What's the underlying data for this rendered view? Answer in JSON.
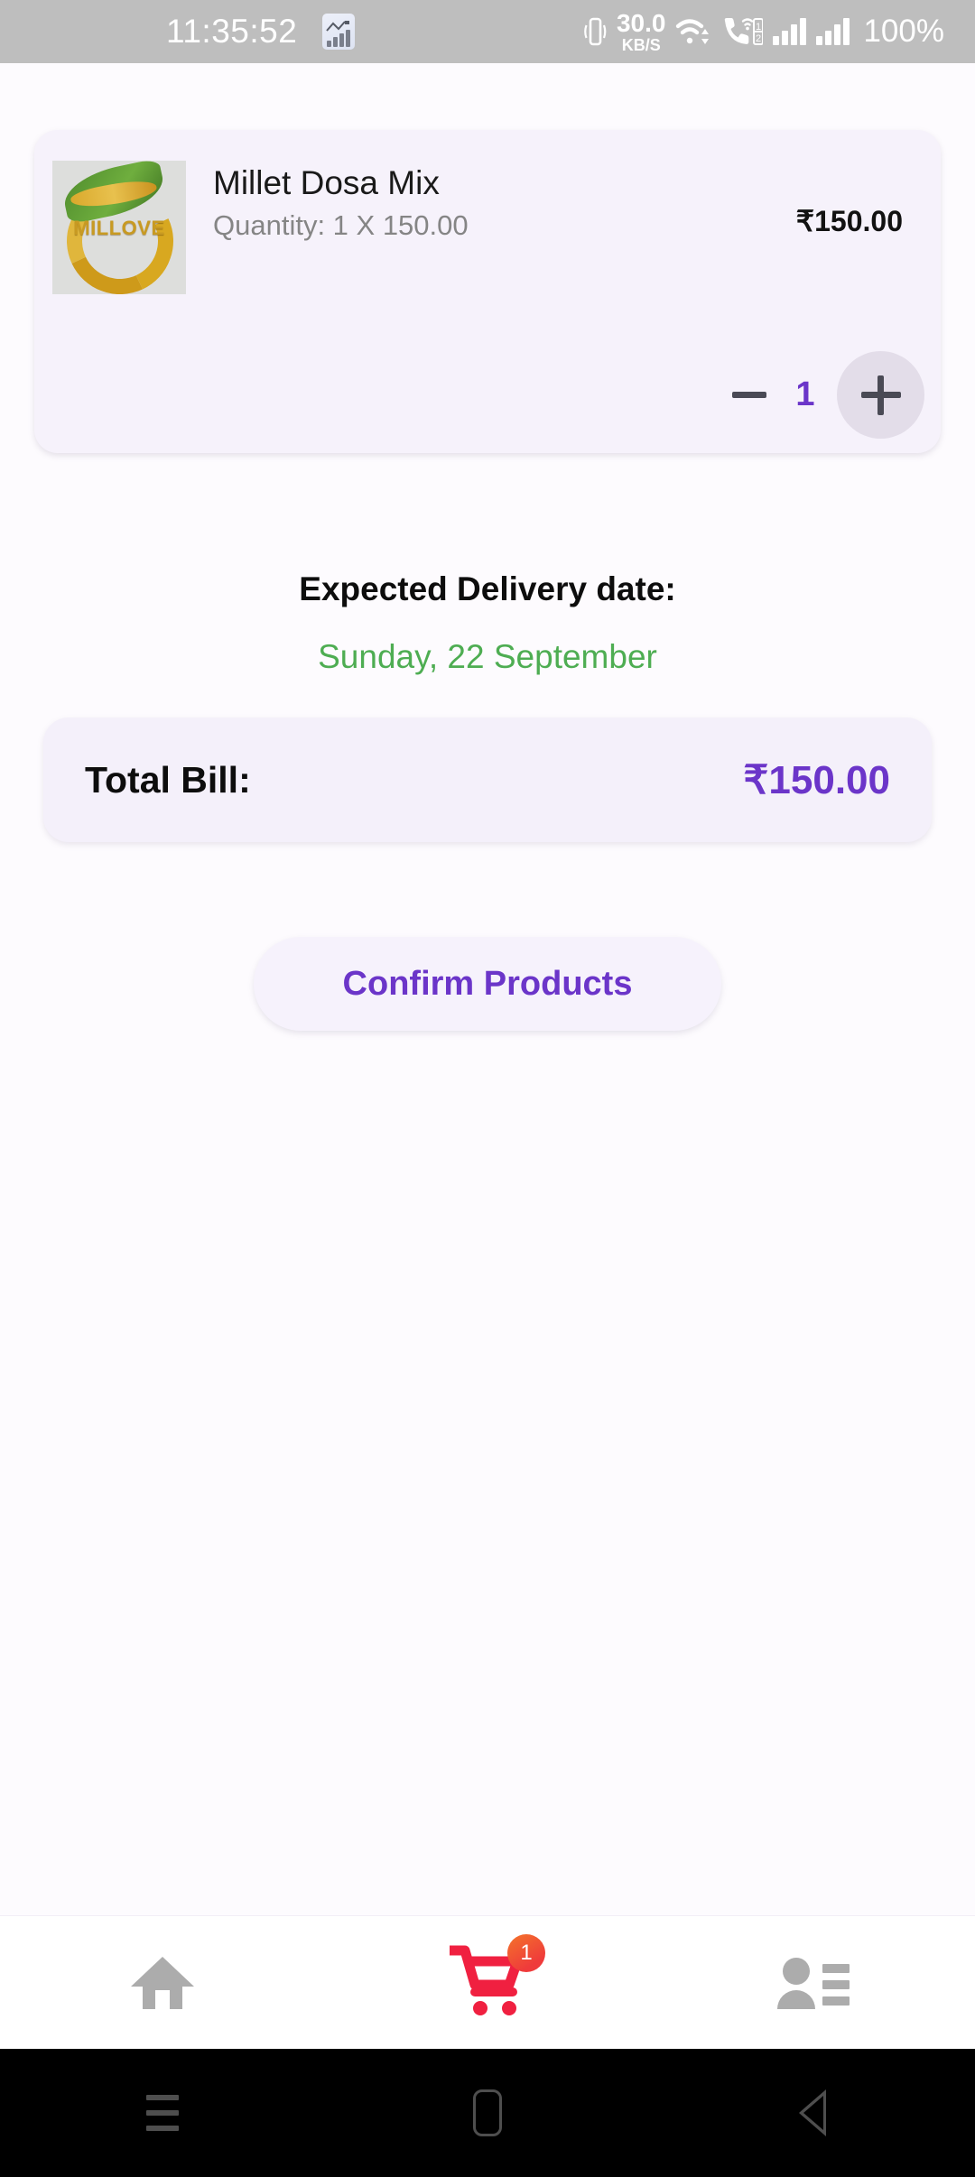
{
  "status_bar": {
    "clock": "11:35:52",
    "notification_icon": "stock-chart-icon",
    "vibrate_icon": "vibrate-icon",
    "network_speed_value": "30.0",
    "network_speed_unit": "KB/S",
    "wifi_icon": "wifi-icon",
    "call_wifi_icon": "vowifi-call-icon",
    "dual_sim_top": "1",
    "dual_sim_bottom": "2",
    "signal_icon_1": "signal-bars-icon",
    "signal_icon_2": "signal-bars-icon",
    "battery_percent": "100%",
    "background_color": "#BEBEBE",
    "text_color": "#FFFFFF"
  },
  "product": {
    "thumbnail_brand": "MILLOVE",
    "thumbnail_alt": "millet-product-image",
    "title": "Millet Dosa Mix",
    "quantity_line": "Quantity: 1 X 150.00",
    "price": "₹150.00",
    "stepper": {
      "decrease_label": "−",
      "value": "1",
      "increase_label": "+",
      "value_color": "#6B35C9",
      "plus_button_bg": "#E3DDE9"
    },
    "card_background": "#F6F2FB"
  },
  "delivery": {
    "label": "Expected Delivery date:",
    "date": "Sunday, 22 September",
    "date_color": "#4EAD52"
  },
  "total": {
    "label": "Total Bill:",
    "amount": "₹150.00",
    "amount_color": "#6B35C9",
    "card_background": "#F4F0FA"
  },
  "actions": {
    "confirm_label": "Confirm Products",
    "confirm_text_color": "#6B35C9",
    "confirm_background": "#F6F2FC"
  },
  "bottom_nav": {
    "items": [
      {
        "name": "home",
        "icon": "home-icon",
        "color": "#ACACAC",
        "badge": ""
      },
      {
        "name": "cart",
        "icon": "shopping-cart-icon",
        "color": "#F02040",
        "badge": "1"
      },
      {
        "name": "account",
        "icon": "person-list-icon",
        "color": "#ACACAC",
        "badge": ""
      }
    ],
    "badge_color": "#EF3B3B",
    "background": "#FFFFFF"
  },
  "system_nav": {
    "recents_icon": "recents-menu-icon",
    "home_icon": "home-square-icon",
    "back_icon": "back-triangle-icon",
    "background": "#000000",
    "icon_color": "#4E4E4E"
  },
  "theme": {
    "page_background": "#FDFBFE",
    "accent_purple": "#6B35C9",
    "accent_green": "#4EAD52"
  }
}
